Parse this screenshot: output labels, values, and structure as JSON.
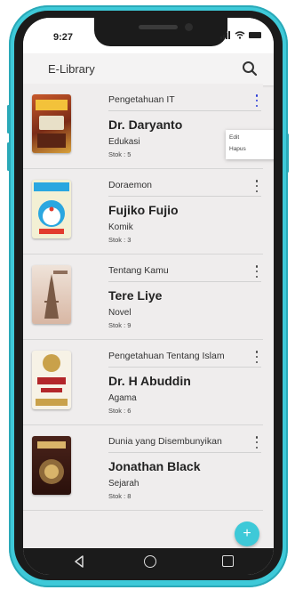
{
  "status": {
    "time": "9:27"
  },
  "appbar": {
    "title": "E-Library",
    "search_icon": "search-icon"
  },
  "books": [
    {
      "category": "Pengetahuan IT",
      "author": "Dr. Daryanto",
      "genre": "Edukasi",
      "stock": "Stok : 5",
      "cover_color": "#8a3b22",
      "menu_open": true
    },
    {
      "category": "Doraemon",
      "author": "Fujiko Fujio",
      "genre": "Komik",
      "stock": "Stok : 3",
      "cover_color": "#2aa7e0",
      "menu_open": false
    },
    {
      "category": "Tentang Kamu",
      "author": "Tere Liye",
      "genre": "Novel",
      "stock": "Stok : 9",
      "cover_color": "#e7d3c6",
      "menu_open": false
    },
    {
      "category": "Pengetahuan Tentang Islam",
      "author": "Dr. H Abuddin",
      "genre": "Agama",
      "stock": "Stok : 6",
      "cover_color": "#f5f1e8",
      "menu_open": false
    },
    {
      "category": "Dunia yang Disembunyikan",
      "author": "Jonathan Black",
      "genre": "Sejarah",
      "stock": "Stok : 8",
      "cover_color": "#3a1a14",
      "menu_open": false
    }
  ],
  "popup_menu": {
    "edit": "Edit",
    "delete": "Hapus"
  },
  "fab": {
    "label": "+"
  },
  "nav": {
    "back": "back-icon",
    "home": "home-icon",
    "recent": "recent-apps-icon"
  },
  "colors": {
    "accent": "#3ec9d8",
    "active_menu": "#2b3bd6"
  }
}
